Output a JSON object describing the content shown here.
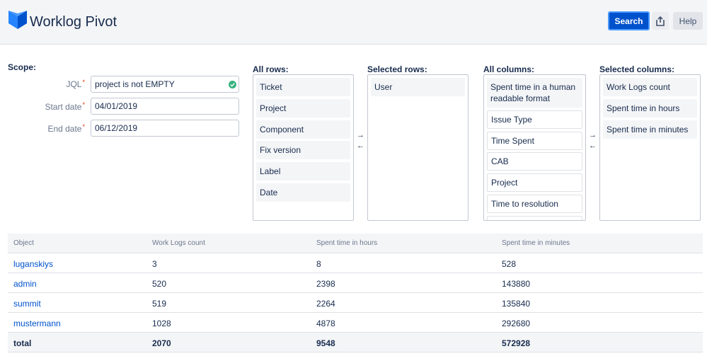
{
  "header": {
    "title": "Worklog Pivot",
    "search_label": "Search",
    "help_label": "Help",
    "share_icon": "share-icon",
    "logo_icon": "tempo-logo-icon"
  },
  "scope": {
    "label": "Scope:",
    "jql_label": "JQL",
    "jql_value": "project is not EMPTY",
    "start_label": "Start date",
    "start_value": "04/01/2019",
    "end_label": "End date",
    "end_value": "06/12/2019",
    "required_mark": "*"
  },
  "all_rows": {
    "title": "All rows:",
    "items": [
      "Ticket",
      "Project",
      "Component",
      "Fix version",
      "Label",
      "Date"
    ]
  },
  "selected_rows": {
    "title": "Selected rows:",
    "items": [
      "User"
    ]
  },
  "all_columns": {
    "title": "All columns:",
    "items": [
      "Spent time in a human readable format",
      "Issue Type",
      "Time Spent",
      "CAB",
      "Project",
      "Time to resolution"
    ]
  },
  "selected_columns": {
    "title": "Selected columns:",
    "items": [
      "Work Logs count",
      "Spent time in hours",
      "Spent time in minutes"
    ]
  },
  "arrows": {
    "right": "→",
    "left": "←"
  },
  "table": {
    "headers": [
      "Object",
      "Work Logs count",
      "Spent time in hours",
      "Spent time in minutes"
    ],
    "rows": [
      [
        "luganskiys",
        "3",
        "8",
        "528"
      ],
      [
        "admin",
        "520",
        "2398",
        "143880"
      ],
      [
        "summit",
        "519",
        "2264",
        "135840"
      ],
      [
        "mustermann",
        "1028",
        "4878",
        "292680"
      ]
    ],
    "total": [
      "total",
      "2070",
      "9548",
      "572928"
    ]
  },
  "colors": {
    "accent": "#0052cc",
    "success": "#36b37e",
    "required": "#de350b"
  }
}
